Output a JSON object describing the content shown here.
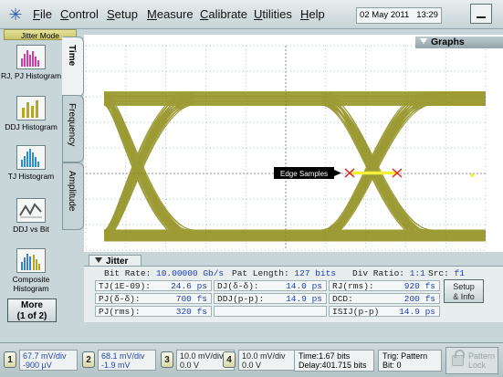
{
  "menubar": {
    "logo_icon": "agilent-spark-icon",
    "items": [
      {
        "label": "File"
      },
      {
        "label": "Control"
      },
      {
        "label": "Setup"
      },
      {
        "label": "Measure"
      },
      {
        "label": "Calibrate"
      },
      {
        "label": "Utilities"
      },
      {
        "label": "Help"
      }
    ],
    "date": "02 May 2011",
    "time": "13:29",
    "window_button_icon": "minimize-icon"
  },
  "left_panel": {
    "mode_title": "Jitter Mode",
    "tools": [
      {
        "label": "RJ, PJ Histogram",
        "icon": "histogram-icon"
      },
      {
        "label": "DDJ Histogram",
        "icon": "histogram-icon"
      },
      {
        "label": "TJ Histogram",
        "icon": "histogram-icon"
      },
      {
        "label": "DDJ vs Bit",
        "icon": "ddj-vs-bit-icon"
      },
      {
        "label": "Composite Histogram",
        "icon": "histogram-icon"
      }
    ],
    "more_button": {
      "line1": "More",
      "line2": "(1 of 2)"
    }
  },
  "tabs": [
    {
      "label": "Time",
      "active": true
    },
    {
      "label": "Frequency",
      "active": false
    },
    {
      "label": "Amplitude",
      "active": false
    }
  ],
  "graph": {
    "panel_label": "Graphs",
    "annotation": "Edge Samples",
    "trace_color": "#8b8a12",
    "marker_color": "#e02020",
    "highlight_color": "#f3f03a"
  },
  "jitter": {
    "tab_label": "Jitter",
    "bit_rate_label": "Bit Rate:",
    "bit_rate_value": "10.00000 Gb/s",
    "pat_length_label": "Pat Length:",
    "pat_length_value": "127 bits",
    "div_ratio_label": "Div Ratio:",
    "div_ratio_value": "1:1",
    "src_label": "Src:",
    "src_value": "f1",
    "rows": [
      [
        {
          "label": "TJ(1E-09):",
          "value": "24.6 ps"
        },
        {
          "label": "DJ(δ-δ):",
          "value": "14.0 ps"
        },
        {
          "label": "RJ(rms):",
          "value": "920 fs"
        }
      ],
      [
        {
          "label": "PJ(δ-δ):",
          "value": "700 fs"
        },
        {
          "label": "DDJ(p-p):",
          "value": "14.9 ps"
        },
        {
          "label": "DCD:",
          "value": "200 fs"
        }
      ],
      [
        {
          "label": "PJ(rms):",
          "value": "320 fs"
        },
        {
          "label": "",
          "value": ""
        },
        {
          "label": "ISIJ(p-p)",
          "value": "14.9 ps"
        }
      ]
    ],
    "setup_button": {
      "line1": "Setup",
      "line2": "& Info"
    }
  },
  "bottom": {
    "channels": [
      {
        "num": "1",
        "line1": "67.7 mV/div",
        "line2": "-900 µV"
      },
      {
        "num": "2",
        "line1": "68.1 mV/div",
        "line2": "-1.9 mV"
      },
      {
        "num": "3",
        "line1": "10.0 mV/div",
        "line2": "0.0 V"
      },
      {
        "num": "4",
        "line1": "10.0 mV/div",
        "line2": "0.0 V"
      }
    ],
    "time_line1": "Time:1.67 bits",
    "time_line2": "Delay:401.715 bits",
    "trig_line1": "Trig: Pattern",
    "trig_line2": "Bit: 0",
    "pattern_lock_line1": "Pattern",
    "pattern_lock_line2": "Lock"
  }
}
